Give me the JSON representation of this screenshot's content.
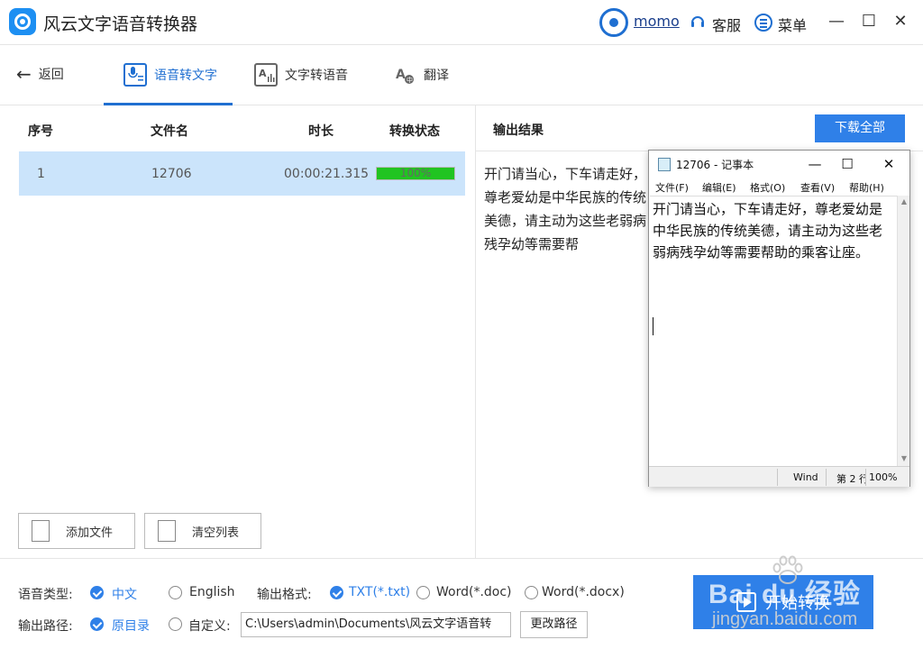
{
  "titlebar": {
    "app_title": "风云文字语音转换器",
    "username": "momo",
    "service_label": "客服",
    "menu_label": "菜单",
    "minimize": "—",
    "maximize": "☐",
    "close": "✕"
  },
  "nav": {
    "back_label": "返回",
    "tabs": [
      {
        "label": "语音转文字",
        "icon": "voice-to-text-icon",
        "active": true
      },
      {
        "label": "文字转语音",
        "icon": "text-to-voice-icon",
        "active": false
      },
      {
        "label": "翻译",
        "icon": "translate-icon",
        "active": false
      }
    ]
  },
  "file_list": {
    "headers": [
      "序号",
      "文件名",
      "时长",
      "转换状态"
    ],
    "rows": [
      {
        "index": "1",
        "filename": "12706",
        "duration": "00:00:21.315",
        "progress_text": "100%",
        "progress": 1.0
      }
    ],
    "add_file_label": "添加文件",
    "clear_list_label": "清空列表"
  },
  "output": {
    "title": "输出结果",
    "download_all_label": "下载全部",
    "text": "开门请当心，下车请走好，尊老爱幼是中华民族的传统美德，请主动为这些老弱病残孕幼等需要帮"
  },
  "notepad": {
    "title": "12706 - 记事本",
    "menus": [
      "文件(F)",
      "编辑(E)",
      "格式(O)",
      "查看(V)",
      "帮助(H)"
    ],
    "content": "开门请当心，下车请走好，尊老爱幼是中华民族的传统美德，请主动为这些老弱病残孕幼等需要帮助的乘客让座。",
    "status_encoding": "Wind",
    "status_line": "第 2 行",
    "status_zoom": "100%"
  },
  "settings": {
    "voice_type_label": "语音类型:",
    "voice_options": [
      {
        "label": "中文",
        "checked": true
      },
      {
        "label": "English",
        "checked": false
      }
    ],
    "output_format_label": "输出格式:",
    "format_options": [
      {
        "label": "TXT(*.txt)",
        "checked": true
      },
      {
        "label": "Word(*.doc)",
        "checked": false
      },
      {
        "label": "Word(*.docx)",
        "checked": false
      }
    ],
    "output_path_label": "输出路径:",
    "path_options": [
      {
        "label": "原目录",
        "checked": true
      },
      {
        "label": "自定义:",
        "checked": false
      }
    ],
    "path_value": "C:\\Users\\admin\\Documents\\风云文字语音转",
    "change_path_label": "更改路径",
    "start_label": "开始转换"
  },
  "watermark": {
    "brand": "Bai du 经验",
    "url": "jingyan.baidu.com"
  },
  "colors": {
    "accent": "#2f80e8",
    "selected_row": "#cbe4fb",
    "progress_fill": "#21c421"
  }
}
